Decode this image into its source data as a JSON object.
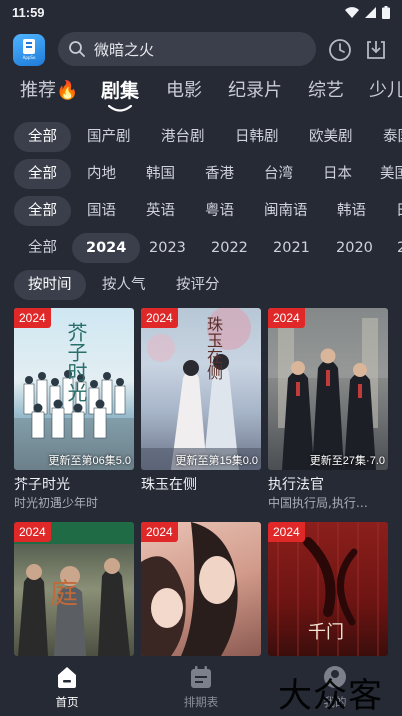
{
  "status_bar": {
    "time": "11:59",
    "icons": [
      "wifi-icon",
      "signal-icon",
      "battery-icon"
    ]
  },
  "header": {
    "logo_icon": "app-logo-icon",
    "logo_tag": "AppSo",
    "search_placeholder": "微暗之火",
    "history_icon": "clock-icon",
    "download_icon": "download-icon"
  },
  "main_tabs": [
    {
      "label": "推荐🔥"
    },
    {
      "label": "剧集",
      "active": true
    },
    {
      "label": "电影"
    },
    {
      "label": "纪录片"
    },
    {
      "label": "综艺"
    },
    {
      "label": "少儿"
    }
  ],
  "filters": {
    "genre": [
      "全部",
      "国产剧",
      "港台剧",
      "日韩剧",
      "欧美剧",
      "泰国"
    ],
    "region": [
      "全部",
      "内地",
      "韩国",
      "香港",
      "台湾",
      "日本",
      "美国"
    ],
    "language": [
      "全部",
      "国语",
      "英语",
      "粤语",
      "闽南语",
      "韩语",
      "日"
    ],
    "year": [
      "全部",
      "2024",
      "2023",
      "2022",
      "2021",
      "2020",
      "2"
    ],
    "sort": [
      "按时间",
      "按人气",
      "按评分"
    ]
  },
  "cards": [
    {
      "year": "2024",
      "episode": "更新至第06集",
      "score": "5.0",
      "title": "芥子时光",
      "subtitle": "时光初遇少年时"
    },
    {
      "year": "2024",
      "episode": "更新至第15集",
      "score": "0.0",
      "title": "珠玉在侧",
      "subtitle": ""
    },
    {
      "year": "2024",
      "episode": "更新至27集",
      "score": "7.0",
      "title": "执行法官",
      "subtitle": "中国执行局,执行…"
    },
    {
      "year": "2024",
      "episode": "",
      "score": "",
      "title": "",
      "subtitle": ""
    },
    {
      "year": "2024",
      "episode": "",
      "score": "",
      "title": "",
      "subtitle": ""
    },
    {
      "year": "2024",
      "episode": "",
      "score": "",
      "title": "",
      "subtitle": ""
    }
  ],
  "poster_texts": [
    "芥子时光",
    "珠玉在侧",
    "庭",
    "千门"
  ],
  "bottom_nav": [
    {
      "label": "首页",
      "icon": "home-icon",
      "active": true
    },
    {
      "label": "排期表",
      "icon": "calendar-icon"
    },
    {
      "label": "我的",
      "icon": "profile-icon"
    }
  ],
  "watermark": "大众客",
  "colors": {
    "background": "#262a35",
    "chip": "#3a3f4b",
    "badge": "#e02828",
    "accent": "#ffffff"
  }
}
